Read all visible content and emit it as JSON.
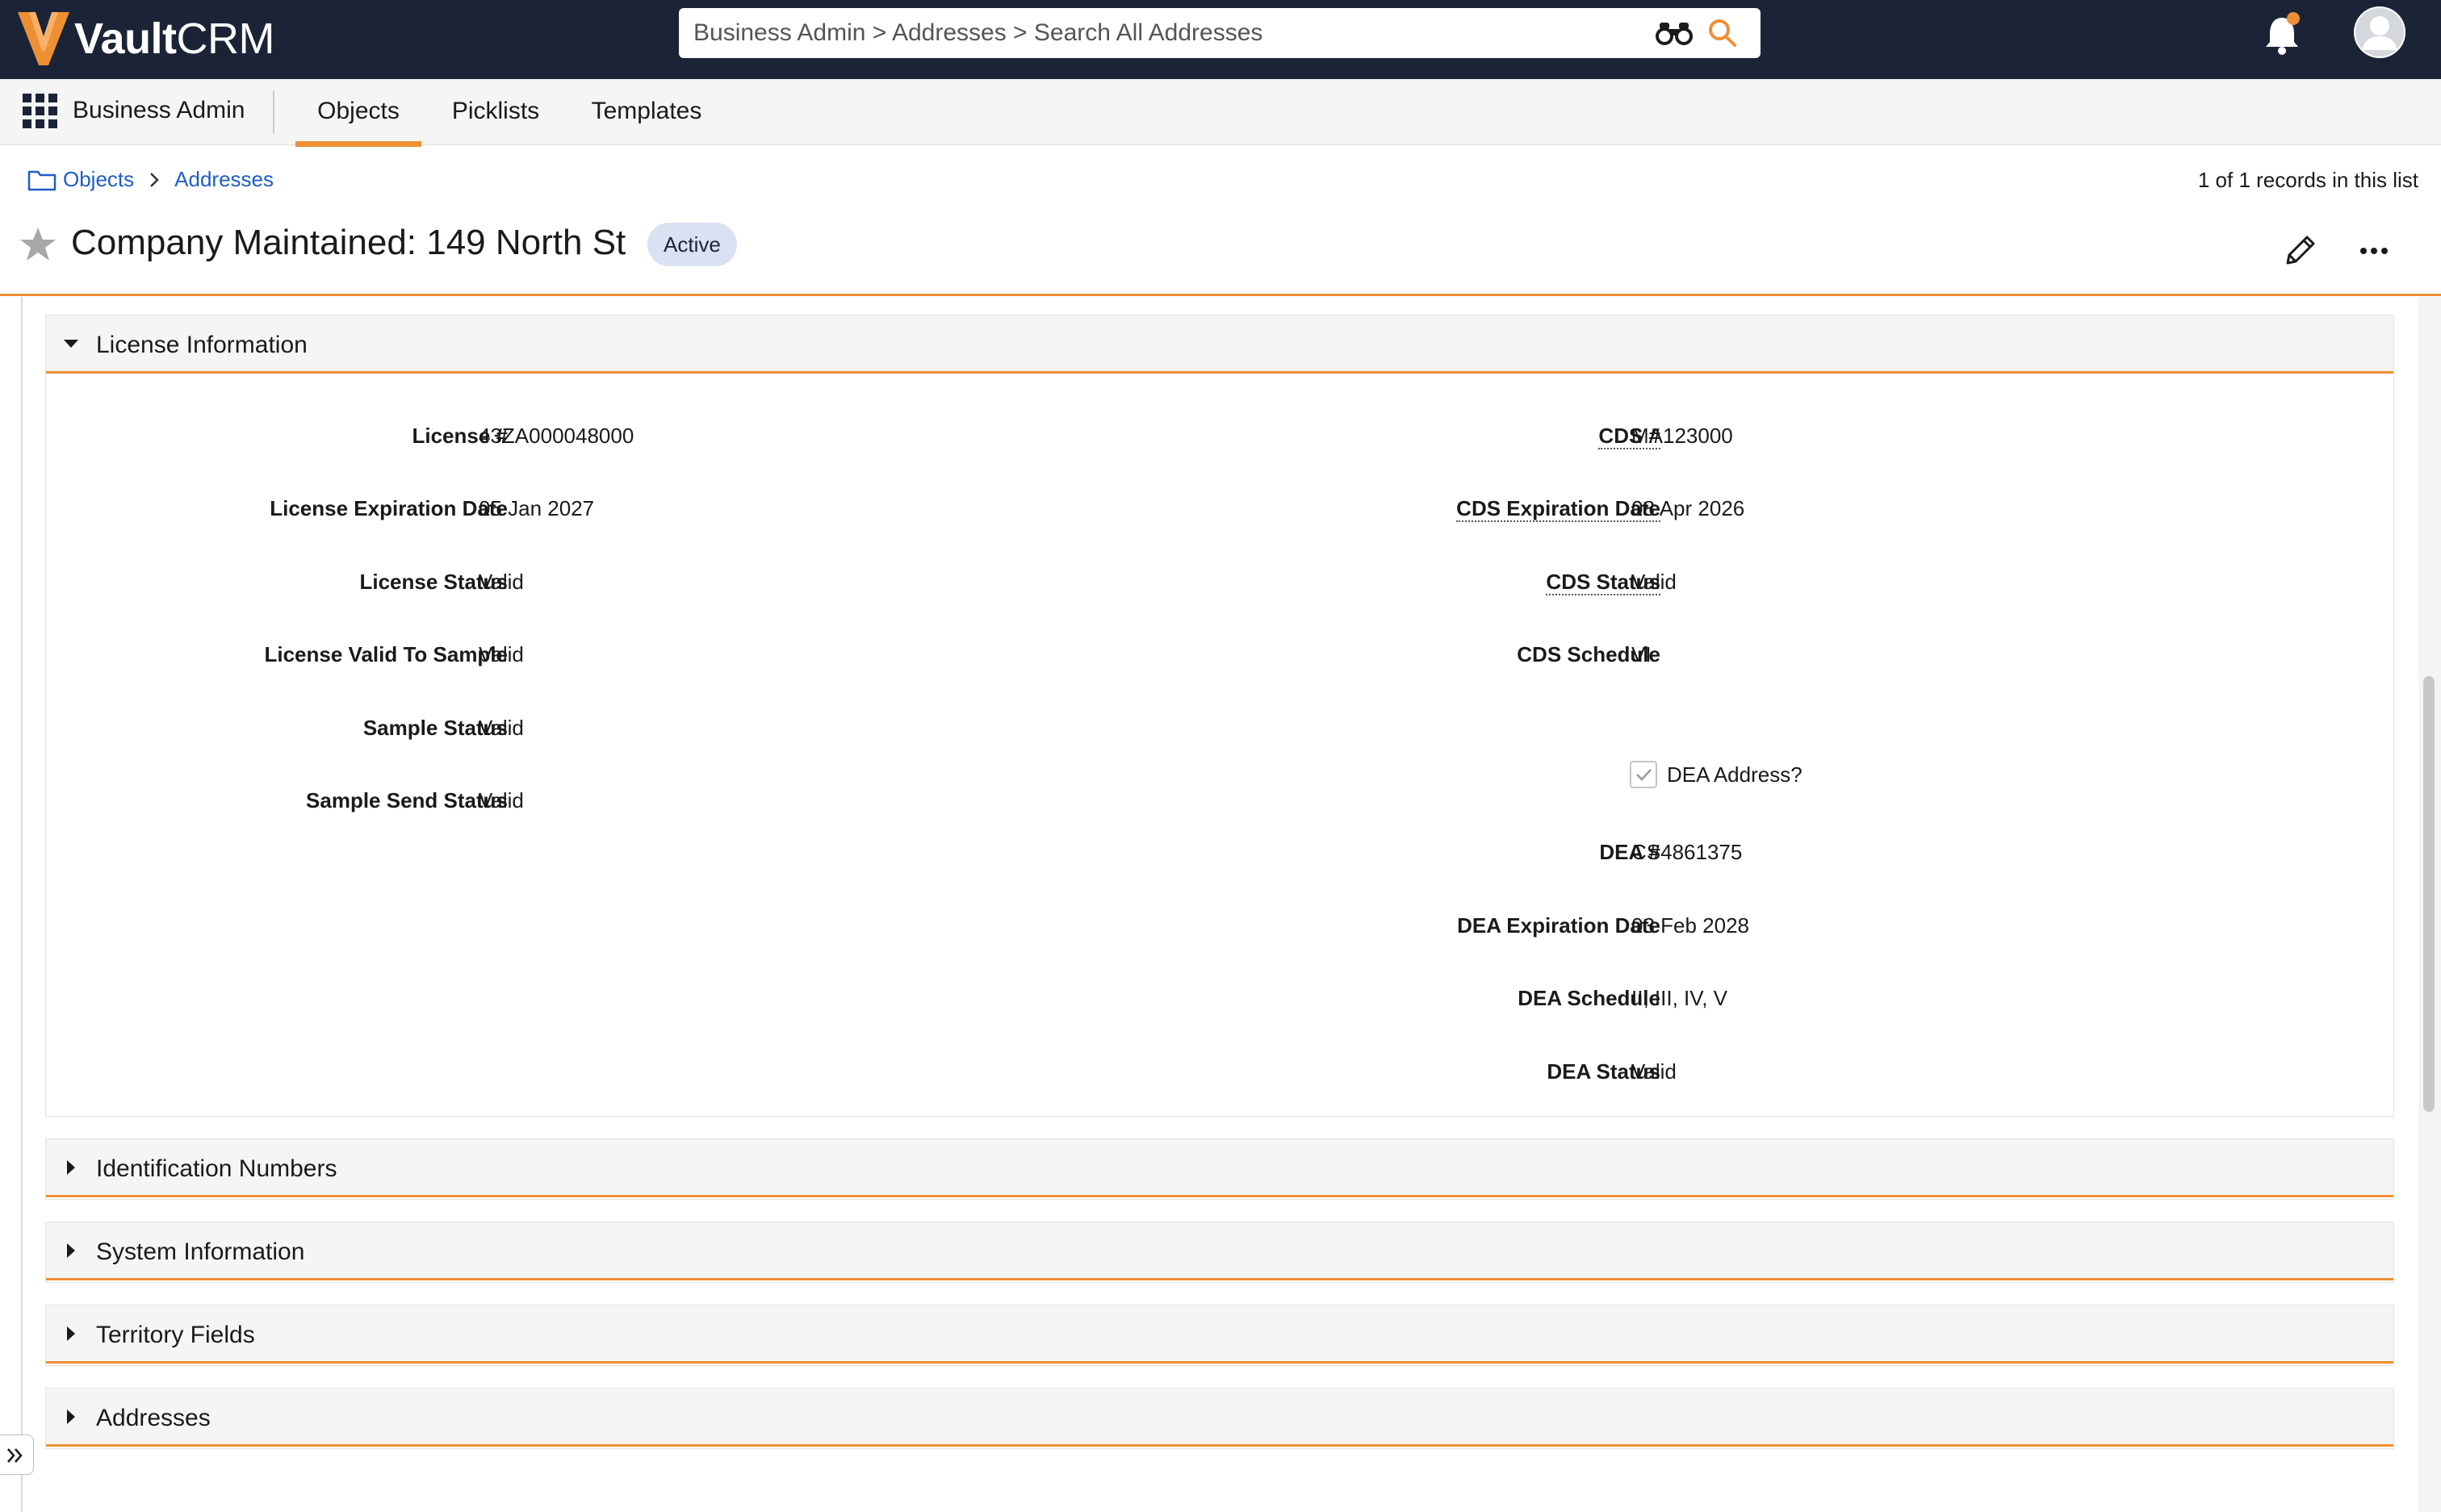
{
  "header": {
    "logo_brand": "Vault",
    "logo_product": "CRM",
    "search_value": "Business Admin > Addresses > Search All Addresses",
    "icons": [
      "vault-v-logo",
      "binoculars-icon",
      "search-icon",
      "bell-icon",
      "user-avatar-icon"
    ],
    "colors": {
      "header_bg": "#1b2437",
      "accent": "#ef8f34",
      "notification_dot": "#ef8f34"
    }
  },
  "nav": {
    "app_name": "Business Admin",
    "tabs": [
      {
        "label": "Objects",
        "active": true
      },
      {
        "label": "Picklists",
        "active": false
      },
      {
        "label": "Templates",
        "active": false
      }
    ]
  },
  "breadcrumb": {
    "items": [
      "Objects",
      "Addresses"
    ]
  },
  "record": {
    "count_text": "1 of 1 records in this list",
    "title": "Company Maintained: 149 North St",
    "status": "Active",
    "colors": {
      "status_badge_bg": "#d9e2f2",
      "link": "#1d5ec9"
    }
  },
  "sections": [
    {
      "title": "License Information",
      "expanded": true,
      "left_fields": [
        {
          "label": "License #",
          "value": "43ZA000048000"
        },
        {
          "label": "License Expiration Date",
          "value": "05 Jan 2027"
        },
        {
          "label": "License Status",
          "value": "Valid"
        },
        {
          "label": "License Valid To Sample",
          "value": "Valid"
        },
        {
          "label": "Sample Status",
          "value": "Valid"
        },
        {
          "label": "Sample Send Status",
          "value": "Valid"
        }
      ],
      "right_fields": [
        {
          "label": "CDS #",
          "value": "MA123000"
        },
        {
          "label": "CDS Expiration Date",
          "value": "08 Apr 2026"
        },
        {
          "label": "CDS Status",
          "value": "Valid"
        },
        {
          "label": "CDS Schedule",
          "value": "VI"
        },
        {
          "label": "DEA #",
          "value": "CS4861375"
        },
        {
          "label": "DEA Expiration Date",
          "value": "03 Feb 2028"
        },
        {
          "label": "DEA Schedule",
          "value": "II, III, IV, V"
        },
        {
          "label": "DEA Status",
          "value": "Valid"
        }
      ],
      "checkbox": {
        "label": "DEA Address?",
        "checked": true
      }
    },
    {
      "title": "Identification Numbers",
      "expanded": false
    },
    {
      "title": "System Information",
      "expanded": false
    },
    {
      "title": "Territory Fields",
      "expanded": false
    },
    {
      "title": "Addresses",
      "expanded": false
    }
  ]
}
